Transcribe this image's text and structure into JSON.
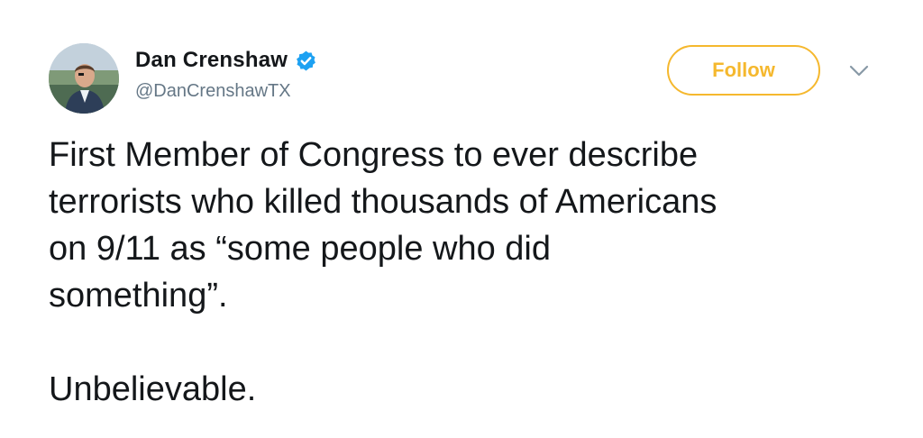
{
  "tweet": {
    "author": {
      "display_name": "Dan Crenshaw",
      "handle": "@DanCrenshawTX",
      "verified": true,
      "verified_icon": "verified-badge-icon",
      "avatar_icon": "avatar"
    },
    "follow_label": "Follow",
    "more_icon": "chevron-down-icon",
    "text": "First Member of Congress to ever describe\nterrorists who killed thousands of Americans\non 9/11 as “some people who did\nsomething”.\n\nUnbelievable."
  },
  "colors": {
    "follow_accent": "#f5b82e",
    "verified_blue": "#1da1f2",
    "handle_gray": "#657786",
    "text": "#14171a"
  }
}
